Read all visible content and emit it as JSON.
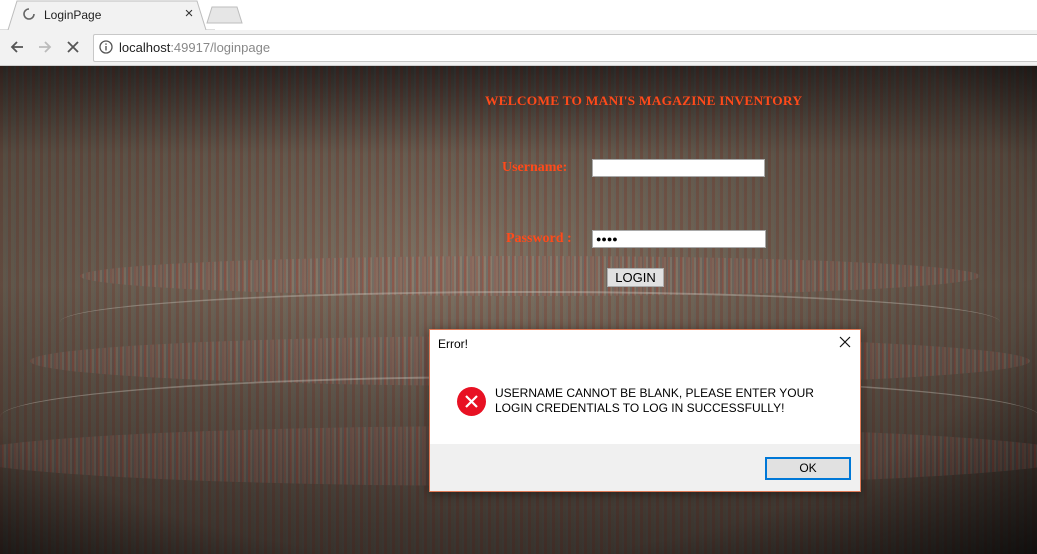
{
  "browser": {
    "tab_title": "LoginPage",
    "tab_close": "×",
    "url_host": "localhost",
    "url_rest": ":49917/loginpage"
  },
  "page": {
    "heading": "WELCOME TO MANI'S MAGAZINE INVENTORY",
    "username_label": "Username:",
    "username_value": "",
    "password_label": "Password :",
    "password_value": "●●●●",
    "login_button": "LOGIN"
  },
  "dialog": {
    "title": "Error!",
    "message": "USERNAME CANNOT BE BLANK, PLEASE ENTER YOUR LOGIN CREDENTIALS TO LOG IN SUCCESSFULLY!",
    "ok_button": "OK",
    "icon": "error-icon"
  },
  "colors": {
    "accent_text": "#ff4a1a",
    "dialog_border": "#e07a57",
    "ok_focus": "#0078d7",
    "error_red": "#e81123"
  }
}
